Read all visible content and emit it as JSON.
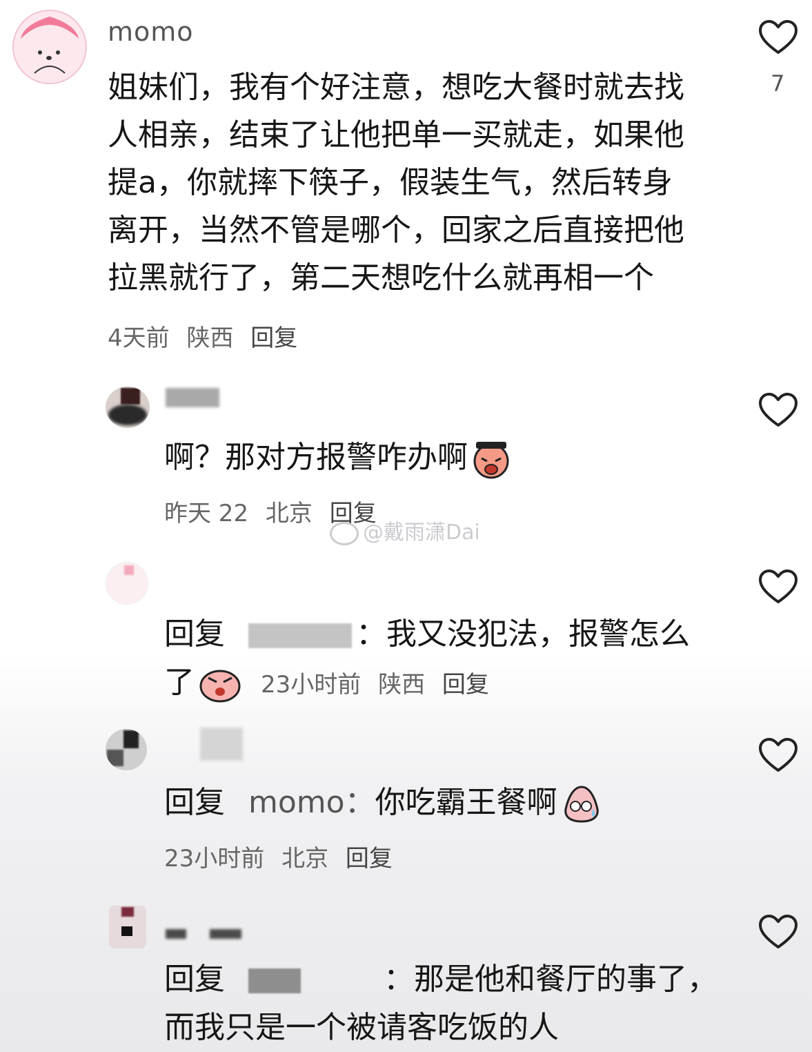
{
  "comments": [
    {
      "author": "momo",
      "text_lines": [
        "姐妹们，我有个好注意，想吃大餐时就去找",
        "人相亲，结束了让他把单一买就走，如果他",
        "提a，你就摔下筷子，假装生气，然后转身",
        "离开，当然不管是哪个，回家之后直接把他",
        "拉黑就行了，第二天想吃什么就再相一个"
      ],
      "time": "4天前",
      "location": "陕西",
      "reply_label": "回复",
      "likes": "7"
    },
    {
      "text": "啊？那对方报警咋办啊",
      "time": "昨天 22",
      "location": "北京",
      "reply_label": "回复"
    },
    {
      "reply_prefix": "回复",
      "text_line1": "：我又没犯法，报警怎么",
      "text_line2": "了",
      "time": "23小时前",
      "location": "陕西",
      "reply_label": "回复"
    },
    {
      "reply_prefix": "回复",
      "mention": "momo：",
      "text": "你吃霸王餐啊",
      "time": "23小时前",
      "location": "北京",
      "reply_label": "回复"
    },
    {
      "reply_prefix": "回复",
      "text_line1": "：那是他和餐厅的事了，",
      "text_line2": "而我只是一个被请客吃饭的人"
    }
  ],
  "watermark": "@戴雨潇Dai",
  "colors": {
    "heart_stroke": "#222222",
    "text": "#161616",
    "meta": "#666666"
  }
}
